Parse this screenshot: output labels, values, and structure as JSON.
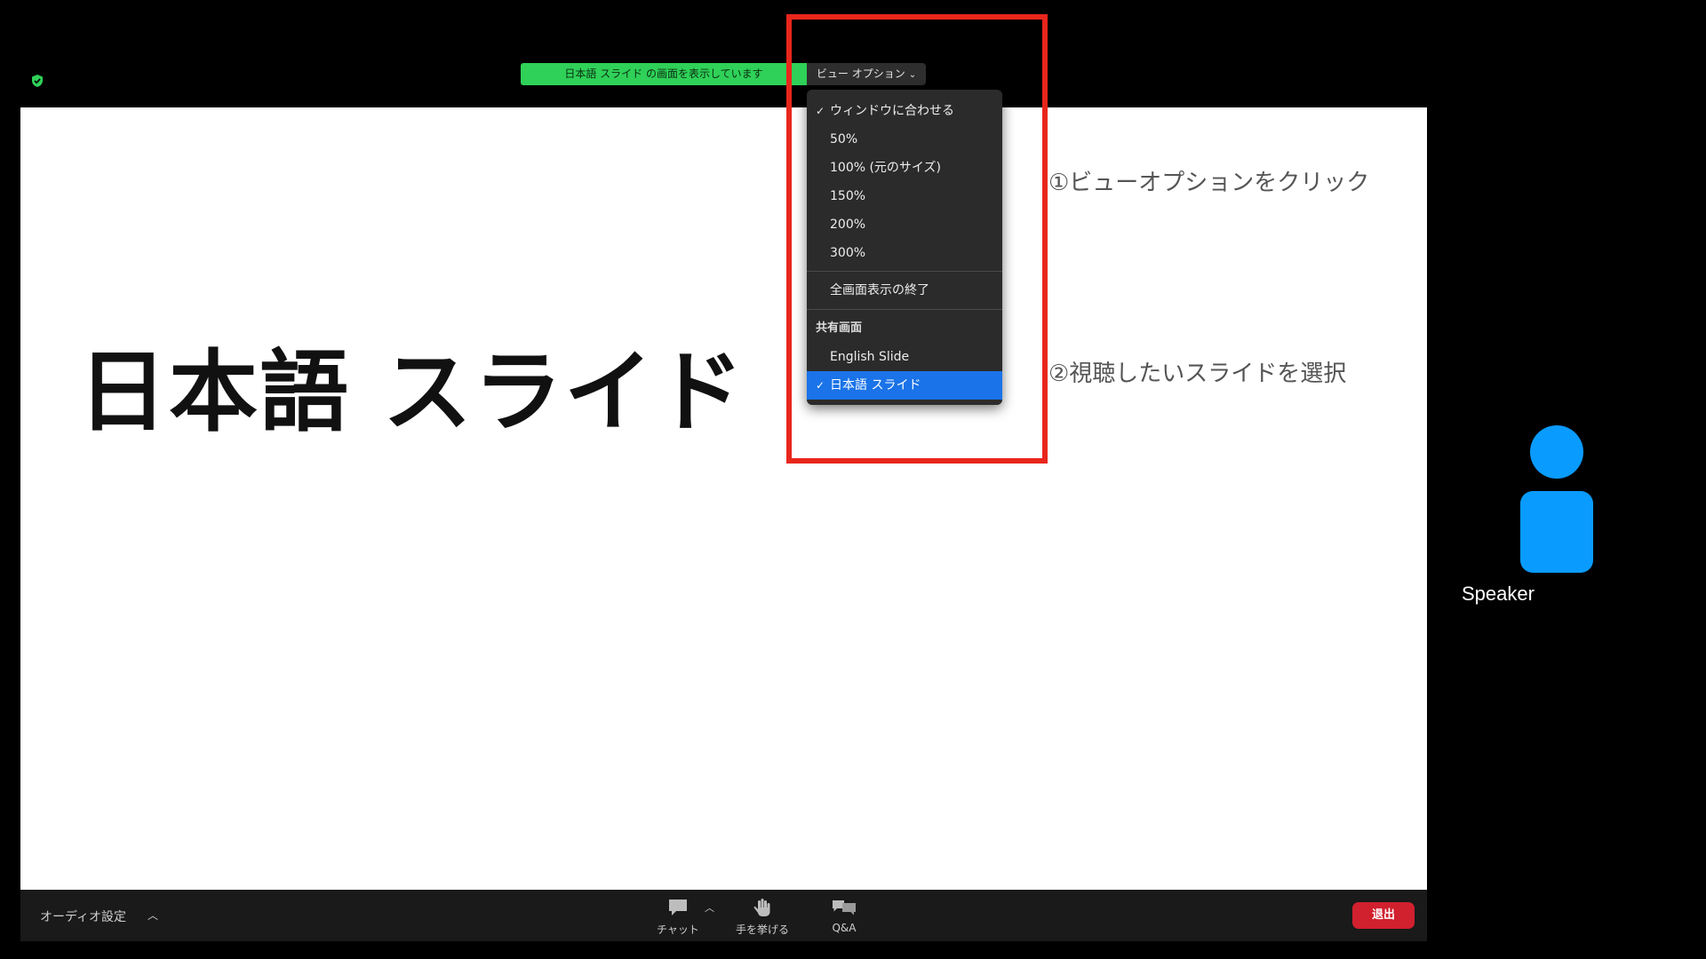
{
  "header": {
    "share_banner": "日本語 スライド の画面を表示しています",
    "view_options_label": "ビュー オプション"
  },
  "view_menu": {
    "items": [
      {
        "label": "ウィンドウに合わせる",
        "checked": true
      },
      {
        "label": "50%"
      },
      {
        "label": "100% (元のサイズ)"
      },
      {
        "label": "150%"
      },
      {
        "label": "200%"
      },
      {
        "label": "300%"
      }
    ],
    "exit_fullscreen": "全画面表示の終了",
    "shared_header": "共有画面",
    "shared_items": [
      {
        "label": "English Slide"
      },
      {
        "label": "日本語 スライド",
        "checked": true
      }
    ],
    "check_glyph": "✓"
  },
  "slide": {
    "title": "日本語 スライド"
  },
  "annotations": {
    "step1": "①ビューオプションをクリック",
    "step2": "②視聴したいスライドを選択"
  },
  "speaker": {
    "name": "Speaker"
  },
  "toolbar": {
    "audio_settings": "オーディオ設定",
    "chat": "チャット",
    "raise_hand": "手を挙げる",
    "qa": "Q&A",
    "leave": "退出"
  },
  "colors": {
    "banner_green": "#2fd158",
    "selected_blue": "#1a73e8",
    "annotation_red": "#e8261c",
    "speaker_blue": "#0a9bff",
    "leave_red": "#d1202e"
  }
}
